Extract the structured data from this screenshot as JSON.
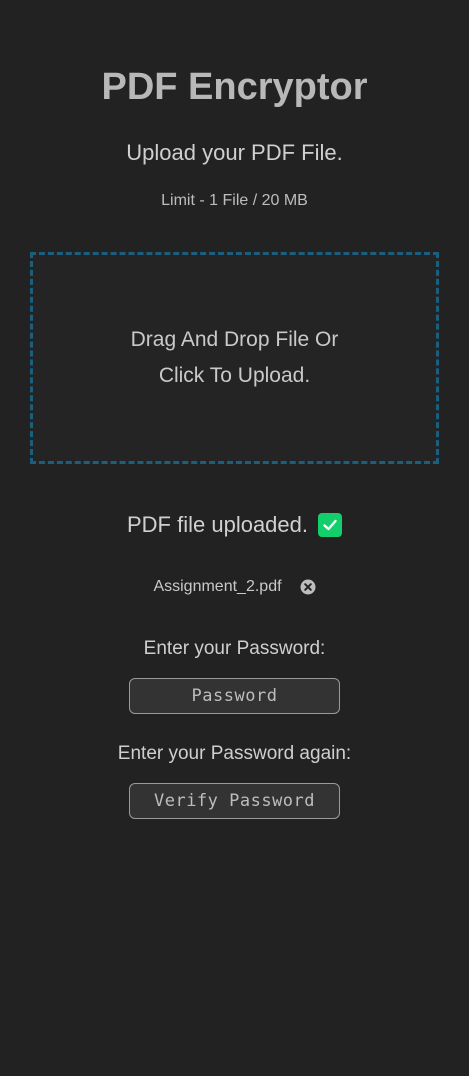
{
  "app": {
    "title": "PDF Encryptor",
    "subtitle": "Upload your PDF File.",
    "limit_text": "Limit - 1 File / 20 MB"
  },
  "dropzone": {
    "line1": "Drag And Drop File Or",
    "line2": "Click To Upload.",
    "border_color": "#1b5f80"
  },
  "status": {
    "uploaded_text": "PDF file uploaded.",
    "icon": "check-icon",
    "icon_color": "#12cf6b"
  },
  "file": {
    "name": "Assignment_2.pdf",
    "remove_icon": "close-circle-icon"
  },
  "password": {
    "label": "Enter your Password:",
    "placeholder": "Password",
    "value": ""
  },
  "verify": {
    "label": "Enter your Password again:",
    "placeholder": "Verify Password",
    "value": ""
  }
}
